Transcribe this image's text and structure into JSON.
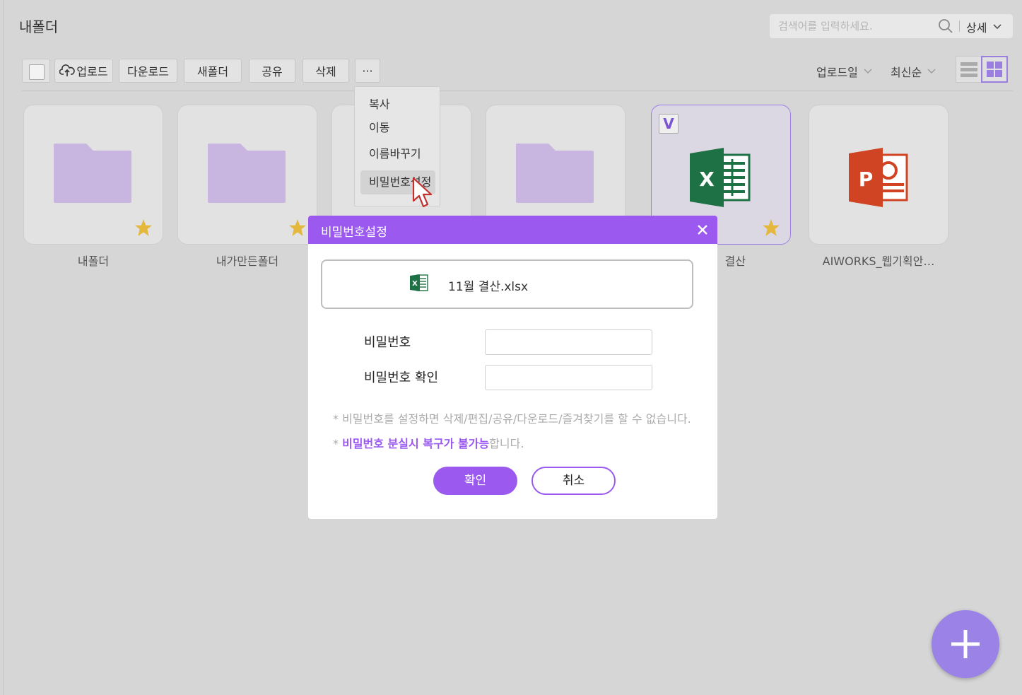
{
  "page": {
    "title": "내폴더"
  },
  "search": {
    "placeholder": "검색어를 입력하세요.",
    "detail_label": "상세"
  },
  "toolbar": {
    "upload": "업로드",
    "download": "다운로드",
    "new_folder": "새폴더",
    "share": "공유",
    "delete": "삭제",
    "more": "···"
  },
  "sort": {
    "by_label": "업로드일",
    "order_label": "최신순"
  },
  "items": [
    {
      "name": "내폴더",
      "type": "folder",
      "starred": true,
      "selected": false
    },
    {
      "name": "내가만든폴더",
      "type": "folder",
      "starred": true,
      "selected": false
    },
    {
      "name": "",
      "type": "folder",
      "starred": false,
      "selected": false
    },
    {
      "name": "",
      "type": "folder",
      "starred": false,
      "selected": false
    },
    {
      "name": "결산",
      "type": "xlsx",
      "starred": true,
      "selected": true,
      "badge": "V"
    },
    {
      "name": "AIWORKS_웹기획안…",
      "type": "pptx",
      "starred": false,
      "selected": false
    }
  ],
  "context_menu": {
    "items": [
      "복사",
      "이동",
      "이름바꾸기",
      "비밀번호설정"
    ],
    "hovered_index": 3
  },
  "modal": {
    "title": "비밀번호설정",
    "file_name": "11월 결산.xlsx",
    "password_label": "비밀번호",
    "confirm_password_label": "비밀번호 확인",
    "password_value": "",
    "confirm_password_value": "",
    "note1": "* 비밀번호를 설정하면 삭제/편집/공유/다운로드/즐겨찾기를 할 수 없습니다.",
    "note2_prefix": "* ",
    "note2_highlight": "비밀번호 분실시 복구가 불가능",
    "note2_suffix": "합니다.",
    "confirm_button": "확인",
    "cancel_button": "취소"
  },
  "colors": {
    "accent": "#9b59f0",
    "fab": "#9b82e6",
    "folder": "#c9b6e0",
    "star": "#e4b83c",
    "excel": "#1e7145",
    "powerpoint": "#d04423"
  },
  "icons": {
    "search": "search-icon",
    "upload": "cloud-upload-icon",
    "close": "close-icon",
    "fab": "plus-icon",
    "list_view": "list-view-icon",
    "grid_view": "grid-view-icon"
  }
}
